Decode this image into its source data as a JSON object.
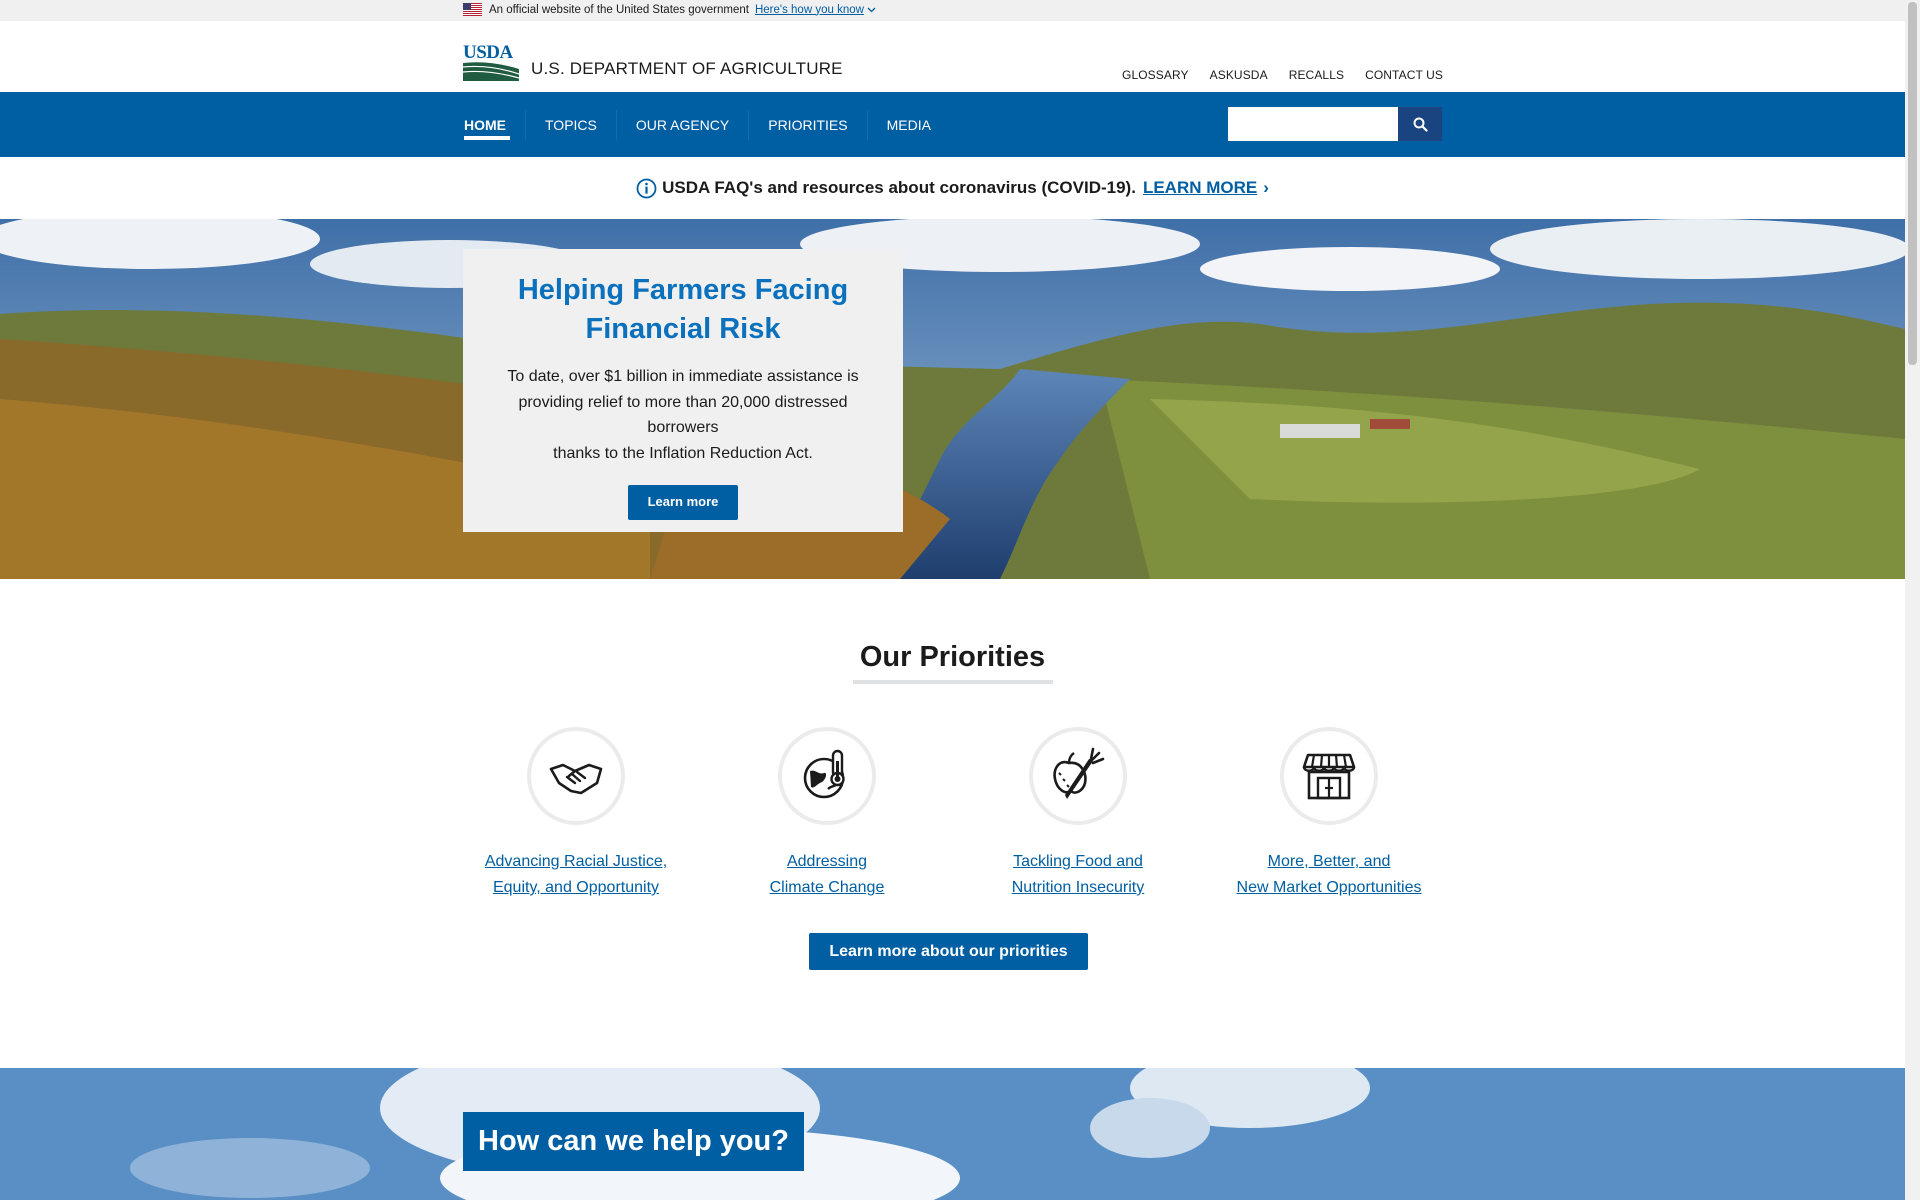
{
  "gov_banner": {
    "text": "An official website of the United States government",
    "link": "Here's how you know"
  },
  "header": {
    "logo_mark": "USDA",
    "agency_name": "U.S. DEPARTMENT OF AGRICULTURE",
    "utility_links": [
      "GLOSSARY",
      "ASKUSDA",
      "RECALLS",
      "CONTACT US"
    ]
  },
  "nav": {
    "items": [
      "HOME",
      "TOPICS",
      "OUR AGENCY",
      "PRIORITIES",
      "MEDIA"
    ],
    "active": "HOME",
    "search_value": ""
  },
  "alert": {
    "text": "USDA FAQ's and resources about coronavirus (COVID-19).",
    "link": "LEARN MORE",
    "arrow": "›"
  },
  "hero": {
    "title_line1": "Helping Farmers Facing",
    "title_line2": "Financial Risk",
    "body_line1": "To date, over $1 billion in immediate assistance is",
    "body_line2": "providing relief to more than 20,000 distressed borrowers",
    "body_line3": "thanks to the Inflation Reduction Act.",
    "button": "Learn more"
  },
  "priorities": {
    "heading": "Our Priorities",
    "items": [
      {
        "icon": "handshake-icon",
        "line1": "Advancing Racial Justice,",
        "line2": "Equity, and Opportunity"
      },
      {
        "icon": "globe-thermometer-icon",
        "line1": "Addressing",
        "line2": "Climate Change"
      },
      {
        "icon": "apple-carrot-icon",
        "line1": "Tackling Food and",
        "line2": "Nutrition Insecurity"
      },
      {
        "icon": "storefront-icon",
        "line1": "More, Better, and",
        "line2": "New Market Opportunities"
      }
    ],
    "button": "Learn more about our priorities"
  },
  "help": {
    "title": "How can we help you?"
  },
  "colors": {
    "primary": "#005ea2",
    "hero_title": "#0b71bd",
    "dark_blue": "#1a4480",
    "banner_bg": "#f0f0f0"
  }
}
